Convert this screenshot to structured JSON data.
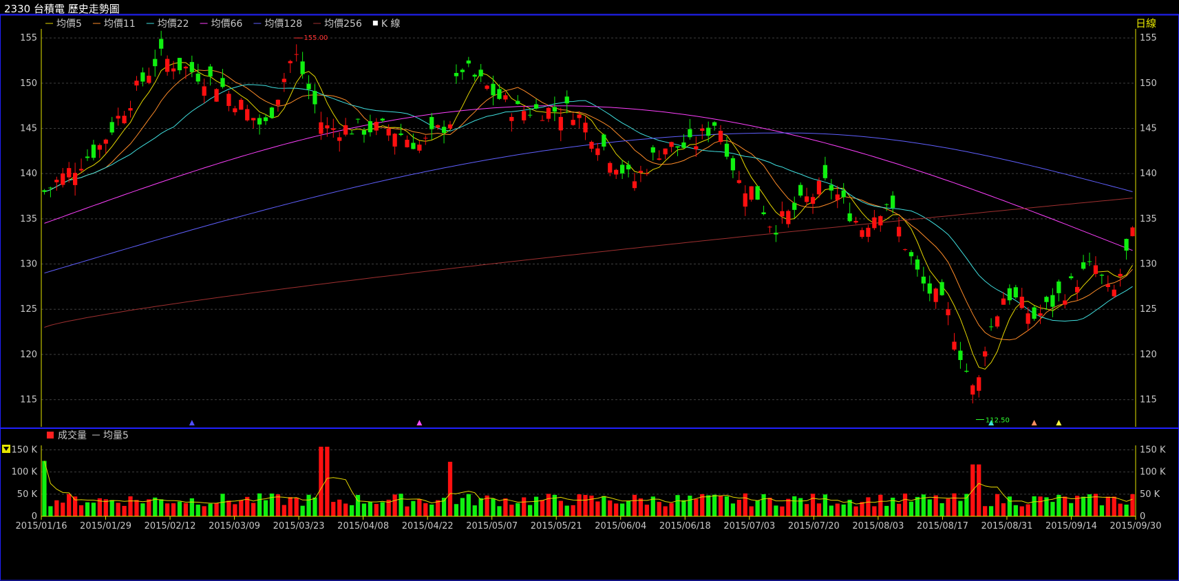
{
  "window": {
    "title": "2330 台積電  歷史走勢圖"
  },
  "price_panel": {
    "legend": [
      {
        "label": "均價5",
        "color": "#e6d800"
      },
      {
        "label": "均價11",
        "color": "#ff8c28"
      },
      {
        "label": "均價22",
        "color": "#40e0e0"
      },
      {
        "label": "均價66",
        "color": "#ff40ff"
      },
      {
        "label": "均價128",
        "color": "#6060ff"
      },
      {
        "label": "均價256",
        "color": "#a03030"
      },
      {
        "label": "K 線",
        "color": "#ffffff"
      }
    ],
    "period_label": "日線",
    "high_label": "155.00",
    "low_label": "112.50",
    "y_ticks": [
      "155",
      "150",
      "145",
      "140",
      "135",
      "130",
      "125",
      "120",
      "115"
    ],
    "markers": [
      {
        "color": "#5050ff",
        "date_index": 24
      },
      {
        "color": "#ff50ff",
        "date_index": 61
      },
      {
        "color": "#40e0e0",
        "date_index": 154
      },
      {
        "color": "#ff9060",
        "date_index": 161
      },
      {
        "color": "#ffff40",
        "date_index": 165
      }
    ]
  },
  "volume_panel": {
    "legend": [
      {
        "label": "成交量",
        "color": "#ff2020"
      },
      {
        "label": "均量5",
        "color": "#e6d800"
      }
    ],
    "y_ticks": [
      "150 K",
      "100 K",
      "50 K",
      "0"
    ]
  },
  "x_ticks": [
    "2015/01/16",
    "2015/01/29",
    "2015/02/12",
    "2015/03/09",
    "2015/03/23",
    "2015/04/08",
    "2015/04/22",
    "2015/05/07",
    "2015/05/21",
    "2015/06/04",
    "2015/06/18",
    "2015/07/03",
    "2015/07/20",
    "2015/08/03",
    "2015/08/17",
    "2015/08/31",
    "2015/09/14",
    "2015/09/30"
  ],
  "colors": {
    "up": "#ff1010",
    "down": "#10f010",
    "flat": "#ffffff",
    "axis": "#e6e600",
    "border": "#2020ff",
    "grid": "#404040"
  },
  "chart_data": {
    "type": "candlestick",
    "y_range": [
      112,
      156
    ],
    "volume_range_k": [
      0,
      160
    ],
    "ohlc_anchor_closes": [
      {
        "date": "2015/01/16",
        "close": 138
      },
      {
        "date": "2015/01/29",
        "close": 143
      },
      {
        "date": "2015/02/12",
        "close": 153
      },
      {
        "date": "2015/02/26",
        "close": 150
      },
      {
        "date": "2015/03/09",
        "close": 145
      },
      {
        "date": "2015/03/16",
        "close": 153.5
      },
      {
        "date": "2015/03/23",
        "close": 145
      },
      {
        "date": "2015/04/08",
        "close": 145
      },
      {
        "date": "2015/04/15",
        "close": 143
      },
      {
        "date": "2015/04/22",
        "close": 146
      },
      {
        "date": "2015/04/24",
        "close": 152
      },
      {
        "date": "2015/05/07",
        "close": 147
      },
      {
        "date": "2015/05/21",
        "close": 147
      },
      {
        "date": "2015/06/04",
        "close": 139
      },
      {
        "date": "2015/06/11",
        "close": 143
      },
      {
        "date": "2015/06/18",
        "close": 143
      },
      {
        "date": "2015/06/24",
        "close": 146
      },
      {
        "date": "2015/06/29",
        "close": 139
      },
      {
        "date": "2015/07/03",
        "close": 138
      },
      {
        "date": "2015/07/07",
        "close": 134
      },
      {
        "date": "2015/07/20",
        "close": 139
      },
      {
        "date": "2015/07/28",
        "close": 134
      },
      {
        "date": "2015/08/03",
        "close": 137
      },
      {
        "date": "2015/08/11",
        "close": 128
      },
      {
        "date": "2015/08/17",
        "close": 125
      },
      {
        "date": "2015/08/24",
        "close": 115
      },
      {
        "date": "2015/08/26",
        "close": 121
      },
      {
        "date": "2015/08/31",
        "close": 127
      },
      {
        "date": "2015/09/07",
        "close": 124
      },
      {
        "date": "2015/09/14",
        "close": 127
      },
      {
        "date": "2015/09/21",
        "close": 130
      },
      {
        "date": "2015/09/25",
        "close": 126
      },
      {
        "date": "2015/09/30",
        "close": 133
      }
    ],
    "moving_averages": {
      "均價128": {
        "start": 129,
        "peak": 144.5,
        "end": 138
      },
      "均價256": {
        "start": 123,
        "end": 137.3
      },
      "均價66": {
        "start": 134.5,
        "peak": 147.5,
        "end": 131.5
      }
    },
    "volume_k_anchors": [
      {
        "date": "2015/01/16",
        "volume": 125
      },
      {
        "date": "2015/03/23",
        "volume": 157
      },
      {
        "date": "2015/04/22",
        "volume": 123
      },
      {
        "date": "2015/08/24",
        "volume": 117
      },
      {
        "date": "2015/09/30",
        "volume": 50
      }
    ]
  }
}
